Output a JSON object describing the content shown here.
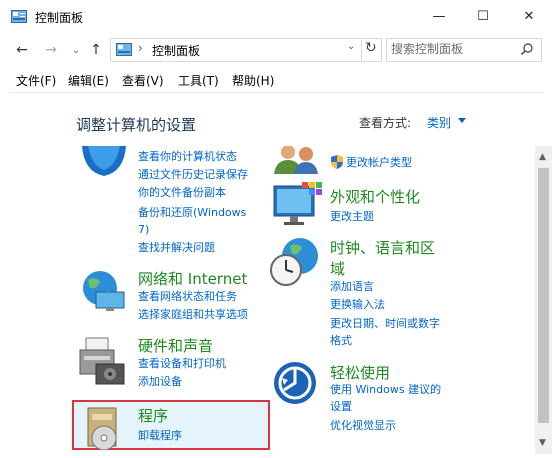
{
  "window": {
    "title": "控制面板",
    "minimize": "—",
    "maximize": "☐",
    "close": "✕"
  },
  "nav": {
    "back": "←",
    "forward": "→",
    "dropdown": "⌄",
    "up": "↑"
  },
  "address": {
    "chevron": "›",
    "path": "控制面板",
    "dropdown": "⌄",
    "refresh": "↻"
  },
  "search": {
    "placeholder": "搜索控制面板",
    "icon": "search-icon"
  },
  "menubar": [
    "文件(F)",
    "编辑(E)",
    "查看(V)",
    "工具(T)",
    "帮助(H)"
  ],
  "content": {
    "heading": "调整计算机的设置",
    "view_by_label": "查看方式:",
    "view_by_value": "类别"
  },
  "categories": {
    "system": {
      "links": [
        "查看你的计算机状态",
        "通过文件历史记录保存",
        "你的文件备份副本",
        "备份和还原(Windows",
        "7)",
        "查找并解决问题"
      ]
    },
    "network": {
      "title": "网络和 Internet",
      "links": [
        "查看网络状态和任务",
        "选择家庭组和共享选项"
      ]
    },
    "hardware": {
      "title": "硬件和声音",
      "links": [
        "查看设备和打印机",
        "添加设备"
      ]
    },
    "programs": {
      "title": "程序",
      "links": [
        "卸载程序"
      ]
    },
    "accounts": {
      "links": [
        "更改帐户类型"
      ]
    },
    "appearance": {
      "title": "外观和个性化",
      "links": [
        "更改主题"
      ]
    },
    "clock": {
      "title_line1": "时钟、语言和区",
      "title_line2": "域",
      "links": [
        "添加语言",
        "更换输入法",
        "更改日期、时间或数字",
        "格式"
      ]
    },
    "ease": {
      "title": "轻松使用",
      "links": [
        "使用 Windows 建议的",
        "设置",
        "优化视觉显示"
      ]
    }
  },
  "colors": {
    "link": "#0066cc",
    "category": "#1e8a1e",
    "heading": "#1e395b",
    "selection_border": "#d9373f",
    "selection_fill": "#e5f3fb"
  }
}
